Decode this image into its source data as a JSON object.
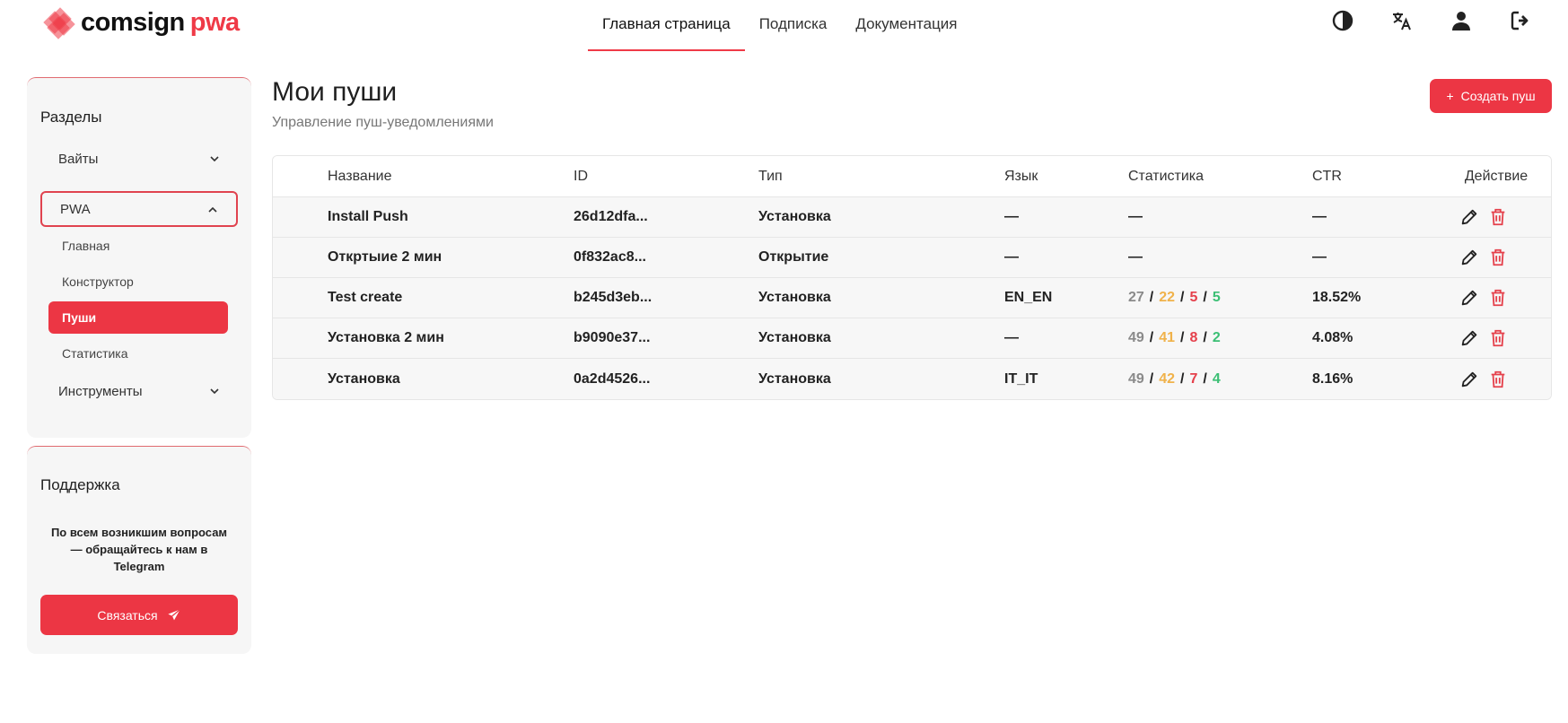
{
  "header": {
    "logo": {
      "main": "comsign",
      "accent": "pwa"
    },
    "nav": [
      {
        "label": "Главная страница",
        "active": true
      },
      {
        "label": "Подписка",
        "active": false
      },
      {
        "label": "Документация",
        "active": false
      }
    ],
    "icons": [
      "contrast-icon",
      "translate-icon",
      "user-icon",
      "logout-icon"
    ]
  },
  "sidebar": {
    "title": "Разделы",
    "items": [
      {
        "label": "Вайты",
        "open": false
      },
      {
        "label": "PWA",
        "open": true
      },
      {
        "label": "Инструменты",
        "open": false
      }
    ],
    "pwa_sub": [
      {
        "label": "Главная",
        "active": false
      },
      {
        "label": "Конструктор",
        "active": false
      },
      {
        "label": "Пуши",
        "active": true
      },
      {
        "label": "Статистика",
        "active": false
      }
    ]
  },
  "support": {
    "title": "Поддержка",
    "text": "По всем возникшим вопросам — обращайтесь к нам в Telegram",
    "button": "Связаться"
  },
  "main": {
    "title": "Мои пуши",
    "subtitle": "Управление пуш-уведомлениями",
    "create_button": "Создать пуш"
  },
  "table": {
    "headers": {
      "name": "Название",
      "id": "ID",
      "type": "Тип",
      "lang": "Язык",
      "stats": "Статистика",
      "ctr": "CTR",
      "action": "Действие"
    },
    "rows": [
      {
        "name": "Install Push",
        "id": "26d12dfa...",
        "type": "Установка",
        "lang": "—",
        "stats": null,
        "stats_empty": "—",
        "ctr": "—"
      },
      {
        "name": "Откртыие 2 мин",
        "id": "0f832ac8...",
        "type": "Открытие",
        "lang": "—",
        "stats": null,
        "stats_empty": "—",
        "ctr": "—"
      },
      {
        "name": "Test create",
        "id": "b245d3eb...",
        "type": "Установка",
        "lang": "EN_EN",
        "stats": [
          "27",
          "22",
          "5",
          "5"
        ],
        "ctr": "18.52%"
      },
      {
        "name": "Установка 2 мин",
        "id": "b9090e37...",
        "type": "Установка",
        "lang": "—",
        "stats": [
          "49",
          "41",
          "8",
          "2"
        ],
        "ctr": "4.08%"
      },
      {
        "name": "Установка",
        "id": "0a2d4526...",
        "type": "Установка",
        "lang": "IT_IT",
        "stats": [
          "49",
          "42",
          "7",
          "4"
        ],
        "ctr": "8.16%"
      }
    ]
  },
  "colors": {
    "accent": "#ec3644",
    "stat_grey": "#8a8a8a",
    "stat_orange": "#f0b24a",
    "stat_red": "#e5404b",
    "stat_green": "#3bbf74"
  }
}
